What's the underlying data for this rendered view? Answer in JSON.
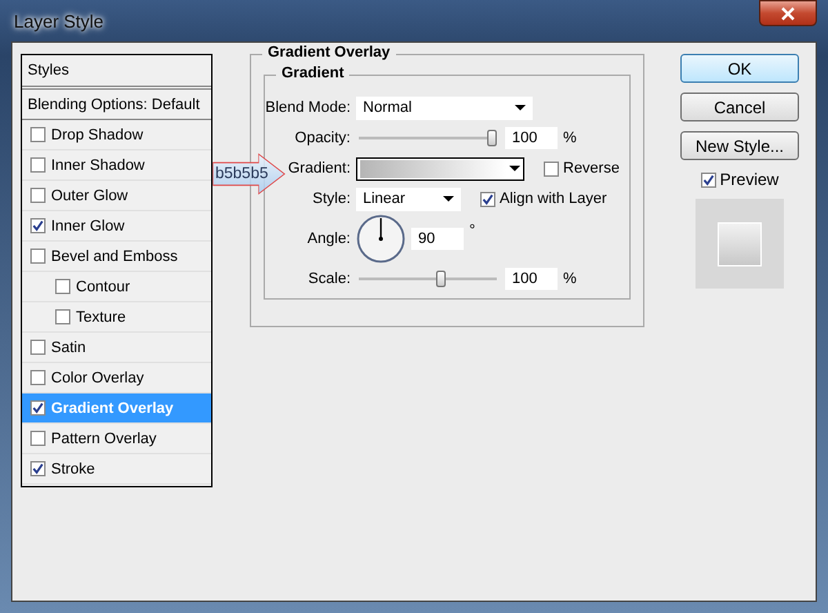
{
  "window": {
    "title": "Layer Style"
  },
  "styles_panel": {
    "header": "Styles",
    "blending_options": "Blending Options: Default",
    "items": [
      {
        "label": "Drop Shadow",
        "checked": false,
        "selected": false
      },
      {
        "label": "Inner Shadow",
        "checked": false,
        "selected": false
      },
      {
        "label": "Outer Glow",
        "checked": false,
        "selected": false
      },
      {
        "label": "Inner Glow",
        "checked": true,
        "selected": false
      },
      {
        "label": "Bevel and Emboss",
        "checked": false,
        "selected": false,
        "children": [
          {
            "label": "Contour",
            "checked": false,
            "selected": false
          },
          {
            "label": "Texture",
            "checked": false,
            "selected": false
          }
        ]
      },
      {
        "label": "Satin",
        "checked": false,
        "selected": false
      },
      {
        "label": "Color Overlay",
        "checked": false,
        "selected": false
      },
      {
        "label": "Gradient Overlay",
        "checked": true,
        "selected": true
      },
      {
        "label": "Pattern Overlay",
        "checked": false,
        "selected": false
      },
      {
        "label": "Stroke",
        "checked": true,
        "selected": false
      }
    ]
  },
  "gradient_overlay": {
    "title": "Gradient Overlay",
    "group_title": "Gradient",
    "blend_mode": {
      "label": "Blend Mode:",
      "value": "Normal"
    },
    "opacity": {
      "label": "Opacity:",
      "level": 1,
      "value": "100",
      "unit": "%"
    },
    "gradient": {
      "label": "Gradient:",
      "reverse": {
        "label": "Reverse",
        "checked": false
      }
    },
    "style": {
      "label": "Style:",
      "value": "Linear",
      "align": {
        "label": "Align with Layer",
        "checked": true
      }
    },
    "angle": {
      "label": "Angle:",
      "value": "90",
      "unit": "°"
    },
    "scale": {
      "label": "Scale:",
      "level": 0.6,
      "value": "100",
      "unit": "%"
    }
  },
  "buttons": [
    {
      "label": "OK",
      "default": true
    },
    {
      "label": "Cancel",
      "default": false
    },
    {
      "label": "New Style...",
      "default": false
    }
  ],
  "preview": {
    "label": "Preview",
    "checked": true
  },
  "callout": {
    "text": "b5b5b5"
  }
}
